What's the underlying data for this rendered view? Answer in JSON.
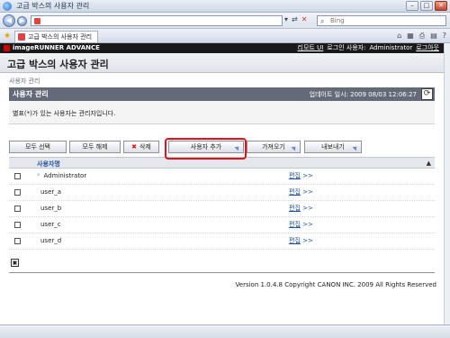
{
  "window": {
    "title": "고급 박스의 사용자 관리"
  },
  "browser": {
    "search_placeholder": "Bing",
    "tab_title": "고급 박스의 사용자 관리"
  },
  "brandbar": {
    "brand": "imageRUNNER ADVANCE",
    "remote_ui": "리모트 UI",
    "login_label": "로그인 사용자:",
    "login_user": "Administrator",
    "logout": "로그아웃"
  },
  "page": {
    "title": "고급 박스의 사용자 관리"
  },
  "breadcrumb": "사용자 관리",
  "panel": {
    "title": "사용자 관리",
    "updated": "업데이트 일시: 2009 08/03 12:06:27",
    "note": "별표(*)가 있는 사용자는 관리자입니다."
  },
  "buttons": {
    "select_all": "모두 선택",
    "clear_all": "모두 해제",
    "delete": "삭제",
    "add_user": "사용자 추가",
    "import": "가져오기",
    "export": "내보내기"
  },
  "table": {
    "column": "사용자명",
    "rows": [
      {
        "name": "Administrator",
        "admin_mark": "*",
        "edit": "편집",
        "arrow": ">>"
      },
      {
        "name": "user_a",
        "admin_mark": "",
        "edit": "편집",
        "arrow": ">>"
      },
      {
        "name": "user_b",
        "admin_mark": "",
        "edit": "편집",
        "arrow": ">>"
      },
      {
        "name": "user_c",
        "admin_mark": "",
        "edit": "편집",
        "arrow": ">>"
      },
      {
        "name": "user_d",
        "admin_mark": "",
        "edit": "편집",
        "arrow": ">>"
      }
    ]
  },
  "footer": {
    "copyright": "Version 1.0.4.8 Copyright CANON INC. 2009 All Rights Reserved"
  },
  "colors": {
    "accent": "#1f4fa0",
    "highlight": "#e0121a",
    "header": "#646a78"
  }
}
